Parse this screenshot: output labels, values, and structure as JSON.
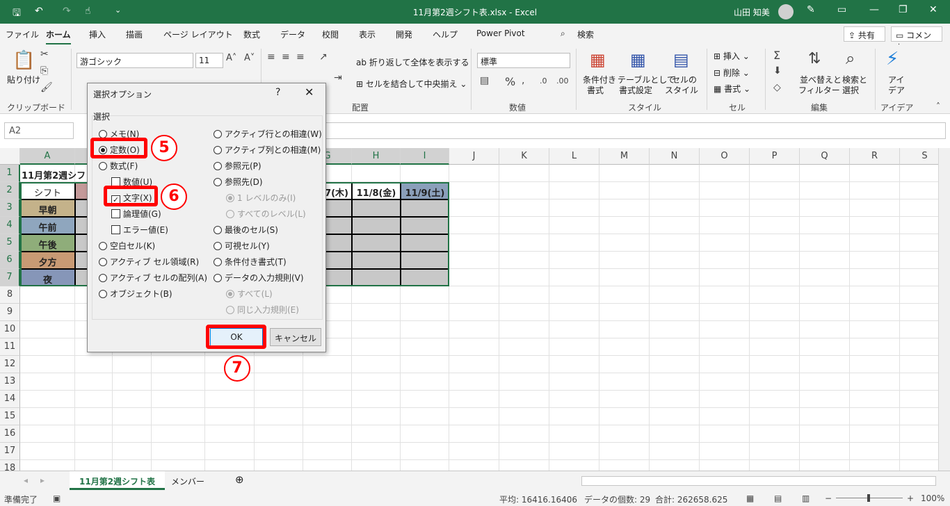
{
  "titlebar": {
    "title": "11月第2週シフト表.xlsx  -  Excel",
    "user": "山田 知美"
  },
  "menu": {
    "tabs": [
      "ファイル",
      "ホーム",
      "挿入",
      "描画",
      "ページ レイアウト",
      "数式",
      "データ",
      "校閲",
      "表示",
      "開発",
      "ヘルプ",
      "Power Pivot"
    ],
    "search": "検索",
    "share": "共有",
    "comment": "コメント"
  },
  "ribbon": {
    "paste": "貼り付け",
    "clipboard": "クリップボード",
    "font_name": "游ゴシック",
    "font_size": "11",
    "wrap": "折り返して全体を表示する",
    "merge": "セルを結合して中央揃え",
    "align_group": "配置",
    "number_format": "標準",
    "number_group": "数値",
    "cond_format_1": "条件付き",
    "cond_format_2": "書式",
    "table_1": "テーブルとして",
    "table_2": "書式設定",
    "cellstyle_1": "セルの",
    "cellstyle_2": "スタイル",
    "style_group": "スタイル",
    "insert": "挿入",
    "delete": "削除",
    "format": "書式",
    "cells_group": "セル",
    "sort_1": "並べ替えと",
    "sort_2": "フィルター",
    "find_1": "検索と",
    "find_2": "選択",
    "edit_group": "編集",
    "ideas_1": "アイ",
    "ideas_2": "デア",
    "ideas_group": "アイデア"
  },
  "namebox": "A2",
  "columns": [
    "A",
    "B",
    "C",
    "D",
    "E",
    "F",
    "G",
    "H",
    "I",
    "J",
    "K",
    "L",
    "M",
    "N",
    "O",
    "P",
    "Q",
    "R",
    "S"
  ],
  "rows": [
    "1",
    "2",
    "3",
    "4",
    "5",
    "6",
    "7",
    "8",
    "9",
    "10",
    "11",
    "12",
    "13",
    "14",
    "15",
    "16",
    "17",
    "18"
  ],
  "sheet": {
    "title_cell": "11月第2週シフト表",
    "header_a2": "シフト",
    "visible_dates": [
      "7(木)",
      "11/8(金)",
      "11/9(土)"
    ],
    "shifts": [
      {
        "label": "早朝",
        "color": "#c4b28a"
      },
      {
        "label": "午前",
        "color": "#8fa6be"
      },
      {
        "label": "午後",
        "color": "#8fad7a"
      },
      {
        "label": "夕方",
        "color": "#c89a74"
      },
      {
        "label": "夜",
        "color": "#8696b8"
      }
    ]
  },
  "sheet_tabs": [
    "11月第2週シフト表",
    "メンバー"
  ],
  "status": {
    "ready": "準備完了",
    "average": "平均: 16416.16406",
    "count": "データの個数: 29",
    "sum": "合計: 262658.625",
    "zoom": "100%"
  },
  "dialog": {
    "title": "選択オプション",
    "help": "?",
    "section": "選択",
    "left_options": [
      {
        "label": "メモ(N)",
        "type": "radio",
        "checked": false,
        "indent": 0,
        "disabled": false
      },
      {
        "label": "定数(O)",
        "type": "radio",
        "checked": true,
        "indent": 0,
        "disabled": false
      },
      {
        "label": "数式(F)",
        "type": "radio",
        "checked": false,
        "indent": 0,
        "disabled": false
      },
      {
        "label": "数値(U)",
        "type": "check",
        "checked": false,
        "indent": 1,
        "disabled": false
      },
      {
        "label": "文字(X)",
        "type": "check",
        "checked": true,
        "indent": 1,
        "disabled": false
      },
      {
        "label": "論理値(G)",
        "type": "check",
        "checked": false,
        "indent": 1,
        "disabled": false
      },
      {
        "label": "エラー値(E)",
        "type": "check",
        "checked": false,
        "indent": 1,
        "disabled": false
      },
      {
        "label": "空白セル(K)",
        "type": "radio",
        "checked": false,
        "indent": 0,
        "disabled": false
      },
      {
        "label": "アクティブ セル領域(R)",
        "type": "radio",
        "checked": false,
        "indent": 0,
        "disabled": false
      },
      {
        "label": "アクティブ セルの配列(A)",
        "type": "radio",
        "checked": false,
        "indent": 0,
        "disabled": false
      },
      {
        "label": "オブジェクト(B)",
        "type": "radio",
        "checked": false,
        "indent": 0,
        "disabled": false
      }
    ],
    "right_options": [
      {
        "label": "アクティブ行との相違(W)",
        "type": "radio",
        "checked": false,
        "indent": 0,
        "disabled": false
      },
      {
        "label": "アクティブ列との相違(M)",
        "type": "radio",
        "checked": false,
        "indent": 0,
        "disabled": false
      },
      {
        "label": "参照元(P)",
        "type": "radio",
        "checked": false,
        "indent": 0,
        "disabled": false
      },
      {
        "label": "参照先(D)",
        "type": "radio",
        "checked": false,
        "indent": 0,
        "disabled": false
      },
      {
        "label": "1 レベルのみ(I)",
        "type": "radio",
        "checked": true,
        "indent": 1,
        "disabled": true
      },
      {
        "label": "すべてのレベル(L)",
        "type": "radio",
        "checked": false,
        "indent": 1,
        "disabled": true
      },
      {
        "label": "最後のセル(S)",
        "type": "radio",
        "checked": false,
        "indent": 0,
        "disabled": false
      },
      {
        "label": "可視セル(Y)",
        "type": "radio",
        "checked": false,
        "indent": 0,
        "disabled": false
      },
      {
        "label": "条件付き書式(T)",
        "type": "radio",
        "checked": false,
        "indent": 0,
        "disabled": false
      },
      {
        "label": "データの入力規則(V)",
        "type": "radio",
        "checked": false,
        "indent": 0,
        "disabled": false
      },
      {
        "label": "すべて(L)",
        "type": "radio",
        "checked": true,
        "indent": 1,
        "disabled": true
      },
      {
        "label": "同じ入力規則(E)",
        "type": "radio",
        "checked": false,
        "indent": 1,
        "disabled": true
      }
    ],
    "ok": "OK",
    "cancel": "キャンセル"
  },
  "annotations": {
    "step5": "5",
    "step6": "6",
    "step7": "7",
    "highlight_color": "#ff0000"
  }
}
